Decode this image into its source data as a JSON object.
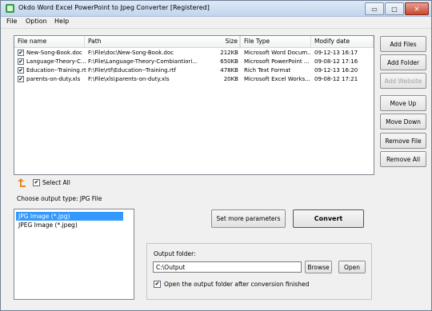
{
  "window": {
    "title": "Okdo Word Excel PowerPoint to Jpeg Converter [Registered]",
    "caption": {
      "minimize": "▭",
      "maximize": "□",
      "close": "✕"
    }
  },
  "menu": {
    "items": [
      "File",
      "Option",
      "Help"
    ]
  },
  "file_list": {
    "columns": [
      "File name",
      "Path",
      "Size",
      "File Type",
      "Modify date"
    ],
    "rows": [
      {
        "checked": true,
        "name": "New-Song-Book.doc",
        "path": "F:\\File\\doc\\New-Song-Book.doc",
        "size": "212KB",
        "type": "Microsoft Word Docum...",
        "date": "09-12-13 16:17"
      },
      {
        "checked": true,
        "name": "Language-Theory-C...",
        "path": "F:\\File\\Language-Theory-Combiantiori...",
        "size": "650KB",
        "type": "Microsoft PowerPoint ...",
        "date": "09-08-12 17:16"
      },
      {
        "checked": true,
        "name": "Education--Training.rtf",
        "path": "F:\\File\\rtf\\Education--Training.rtf",
        "size": "478KB",
        "type": "Rich Text Format",
        "date": "09-12-13 16:20"
      },
      {
        "checked": true,
        "name": "parents-on-duty.xls",
        "path": "F:\\File\\xls\\parents-on-duty.xls",
        "size": "20KB",
        "type": "Microsoft Excel Works...",
        "date": "09-08-12 17:21"
      }
    ]
  },
  "side_buttons": {
    "add_files": "Add Files",
    "add_folder": "Add Folder",
    "add_website": "Add Website",
    "move_up": "Move Up",
    "move_down": "Move Down",
    "remove_file": "Remove File",
    "remove_all": "Remove All"
  },
  "select_all": {
    "checked": true,
    "label": "Select All"
  },
  "output_type": {
    "label": "Choose output type:  JPG File"
  },
  "formats": [
    {
      "label": "JPG Image (*.jpg)",
      "selected": true
    },
    {
      "label": "JPEG Image (*.jpeg)",
      "selected": false
    }
  ],
  "actions": {
    "set_params": "Set more parameters",
    "convert": "Convert"
  },
  "output_folder": {
    "label": "Output folder:",
    "value": "C:\\Output",
    "browse": "Browse",
    "open": "Open",
    "open_after_checked": true,
    "open_after_label": "Open the output folder after conversion finished"
  },
  "check_mark": "✔",
  "colors": {
    "selection": "#3399ff",
    "up_arrow": "#e8891d"
  }
}
